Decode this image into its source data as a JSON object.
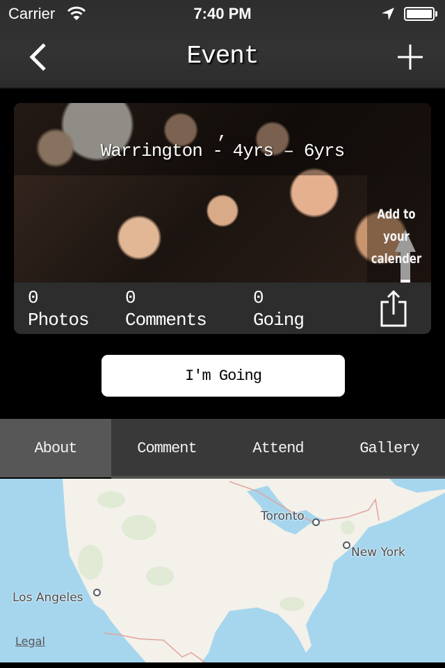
{
  "status_bar": {
    "carrier": "Carrier",
    "time": "7:40 PM",
    "battery_level": 1.0
  },
  "nav": {
    "title": "Event",
    "back_icon": "chevron-left-icon",
    "add_icon": "plus-icon"
  },
  "event": {
    "title_line1": ",",
    "title_line2": "Warrington - 4yrs – 6yrs",
    "calendar_label_line1": "Add to your",
    "calendar_label_line2": "calender",
    "calendar_icon": "arrow-up-icon",
    "stats": [
      {
        "count": "0",
        "label": "Photos"
      },
      {
        "count": "0",
        "label": "Comments"
      },
      {
        "count": "0",
        "label": "Going"
      }
    ],
    "share_icon": "share-icon"
  },
  "going_button": {
    "label": "I'm Going"
  },
  "tabs": [
    {
      "label": "About",
      "active": true
    },
    {
      "label": "Comment",
      "active": false
    },
    {
      "label": "Attend",
      "active": false
    },
    {
      "label": "Gallery",
      "active": false
    }
  ],
  "map": {
    "cities": [
      "Toronto",
      "New York",
      "Los Angeles"
    ],
    "legal_label": "Legal",
    "colors": {
      "water": "#a6d6ee",
      "land": "#f3f1ea",
      "border": "#e3a29a"
    }
  }
}
